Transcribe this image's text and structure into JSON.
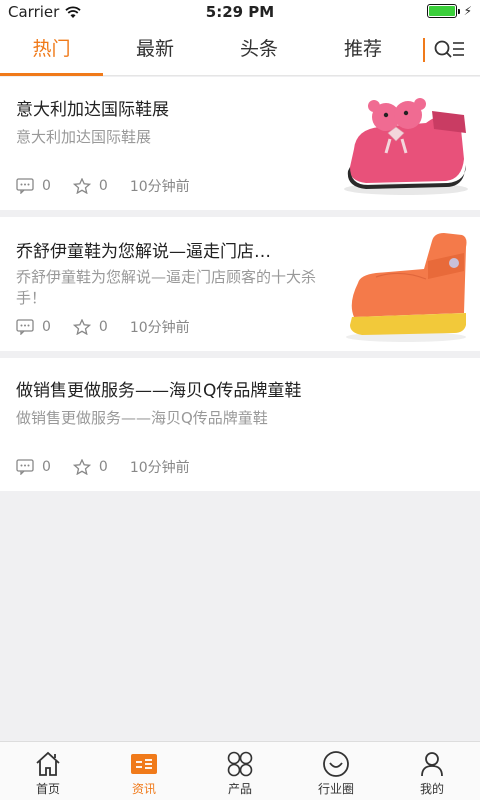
{
  "status": {
    "carrier": "Carrier",
    "time": "5:29 PM"
  },
  "tabs": [
    {
      "label": "热门"
    },
    {
      "label": "最新"
    },
    {
      "label": "头条"
    },
    {
      "label": "推荐"
    }
  ],
  "articles": [
    {
      "title": "意大利加达国际鞋展",
      "summary": "意大利加达国际鞋展",
      "comments": "0",
      "likes": "0",
      "time": "10分钟前",
      "thumb": "pink-shoe"
    },
    {
      "title": "乔舒伊童鞋为您解说—逼走门店…",
      "summary": "乔舒伊童鞋为您解说—逼走门店顾客的十大杀手！",
      "comments": "0",
      "likes": "0",
      "time": "10分钟前",
      "thumb": "orange-boot"
    },
    {
      "title": "做销售更做服务——海贝Q传品牌童鞋",
      "summary": "做销售更做服务——海贝Q传品牌童鞋",
      "comments": "0",
      "likes": "0",
      "time": "10分钟前"
    }
  ],
  "nav": [
    {
      "label": "首页",
      "icon": "home-icon"
    },
    {
      "label": "资讯",
      "icon": "news-icon"
    },
    {
      "label": "产品",
      "icon": "products-icon"
    },
    {
      "label": "行业圈",
      "icon": "community-icon"
    },
    {
      "label": "我的",
      "icon": "profile-icon"
    }
  ],
  "colors": {
    "accent": "#f07a1a",
    "battery": "#3bcf3b"
  }
}
